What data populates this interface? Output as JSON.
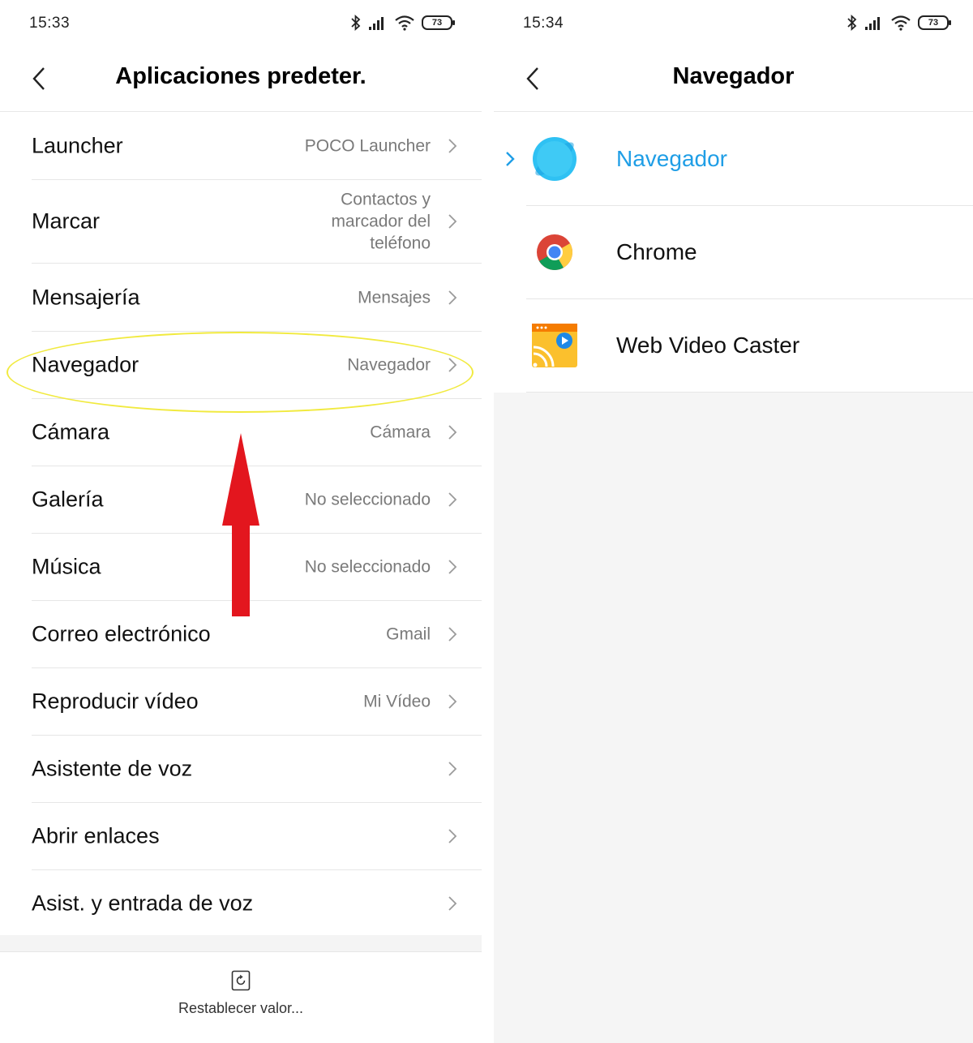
{
  "left": {
    "status": {
      "time": "15:33",
      "battery": "73"
    },
    "title": "Aplicaciones predeter.",
    "items": [
      {
        "label": "Launcher",
        "value": "POCO Launcher"
      },
      {
        "label": "Marcar",
        "value": "Contactos y marcador del teléfono"
      },
      {
        "label": "Mensajería",
        "value": "Mensajes"
      },
      {
        "label": "Navegador",
        "value": "Navegador"
      },
      {
        "label": "Cámara",
        "value": "Cámara"
      },
      {
        "label": "Galería",
        "value": "No seleccionado"
      },
      {
        "label": "Música",
        "value": "No seleccionado"
      },
      {
        "label": "Correo electrónico",
        "value": "Gmail"
      },
      {
        "label": "Reproducir vídeo",
        "value": "Mi Vídeo"
      },
      {
        "label": "Asistente de voz",
        "value": ""
      },
      {
        "label": "Abrir enlaces",
        "value": ""
      },
      {
        "label": "Asist. y entrada de voz",
        "value": ""
      }
    ],
    "reset_label": "Restablecer valor..."
  },
  "right": {
    "status": {
      "time": "15:34",
      "battery": "73"
    },
    "title": "Navegador",
    "apps": [
      {
        "name": "Navegador",
        "icon": "mi-browser-icon",
        "selected": true
      },
      {
        "name": "Chrome",
        "icon": "chrome-icon",
        "selected": false
      },
      {
        "name": "Web Video Caster",
        "icon": "web-video-caster-icon",
        "selected": false
      }
    ]
  },
  "colors": {
    "accent": "#1f9ee6",
    "highlight": "#f1ea3f",
    "arrow": "#e3161e",
    "empty_bg": "#f5f5f5"
  }
}
